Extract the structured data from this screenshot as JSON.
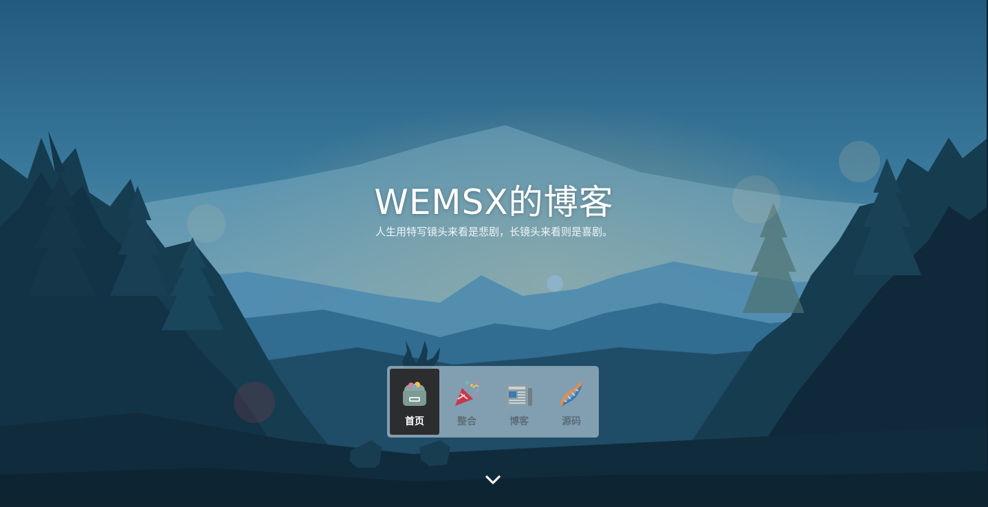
{
  "header": {
    "title": "WEMSX的博客",
    "subtitle": "人生用特写镜头来看是悲剧，长镜头来看则是喜剧。"
  },
  "nav": {
    "items": [
      {
        "label": "首页",
        "icon": "home-icon",
        "active": true
      },
      {
        "label": "整合",
        "icon": "party-popper-icon",
        "active": false
      },
      {
        "label": "博客",
        "icon": "newspaper-icon",
        "active": false
      },
      {
        "label": "源码",
        "icon": "dna-icon",
        "active": false
      }
    ]
  },
  "scroll": {
    "icon": "chevron-down-icon"
  },
  "colors": {
    "sky_top": "#235c80",
    "sky_mid": "#4a8eab",
    "mountain_far": "#6aa6c0",
    "mountain_mid": "#3a79a0",
    "forest_dark": "#123243",
    "nav_bg": "#bed2de",
    "nav_active_bg": "#2c2d2f"
  }
}
